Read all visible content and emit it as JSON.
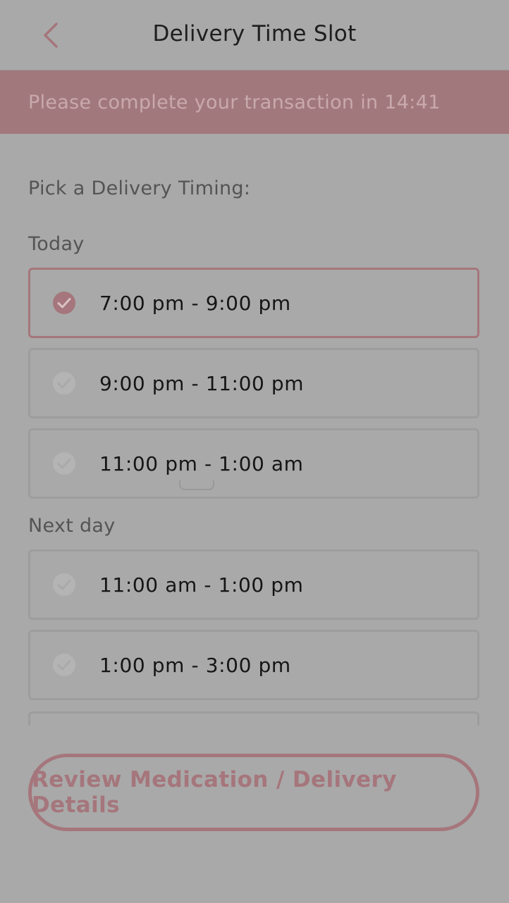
{
  "header": {
    "title": "Delivery Time Slot",
    "back_icon": "chevron-left-icon"
  },
  "timer": {
    "text": "Please complete your transaction in 14:41"
  },
  "prompt": "Pick a Delivery Timing:",
  "groups": [
    {
      "label": "Today",
      "slots": [
        {
          "label": "7:00 pm - 9:00 pm",
          "selected": true
        },
        {
          "label": "9:00 pm - 11:00 pm",
          "selected": false
        },
        {
          "label": "11:00 pm - 1:00 am",
          "selected": false
        }
      ]
    },
    {
      "label": "Next day",
      "slots": [
        {
          "label": "11:00 am - 1:00 pm",
          "selected": false
        },
        {
          "label": "1:00 pm - 3:00 pm",
          "selected": false
        }
      ]
    }
  ],
  "cta": {
    "label": "Review Medication / Delivery Details"
  },
  "colors": {
    "accent": "#a5767c",
    "banner": "#a1787c",
    "unchecked": "#b4b4b4"
  }
}
